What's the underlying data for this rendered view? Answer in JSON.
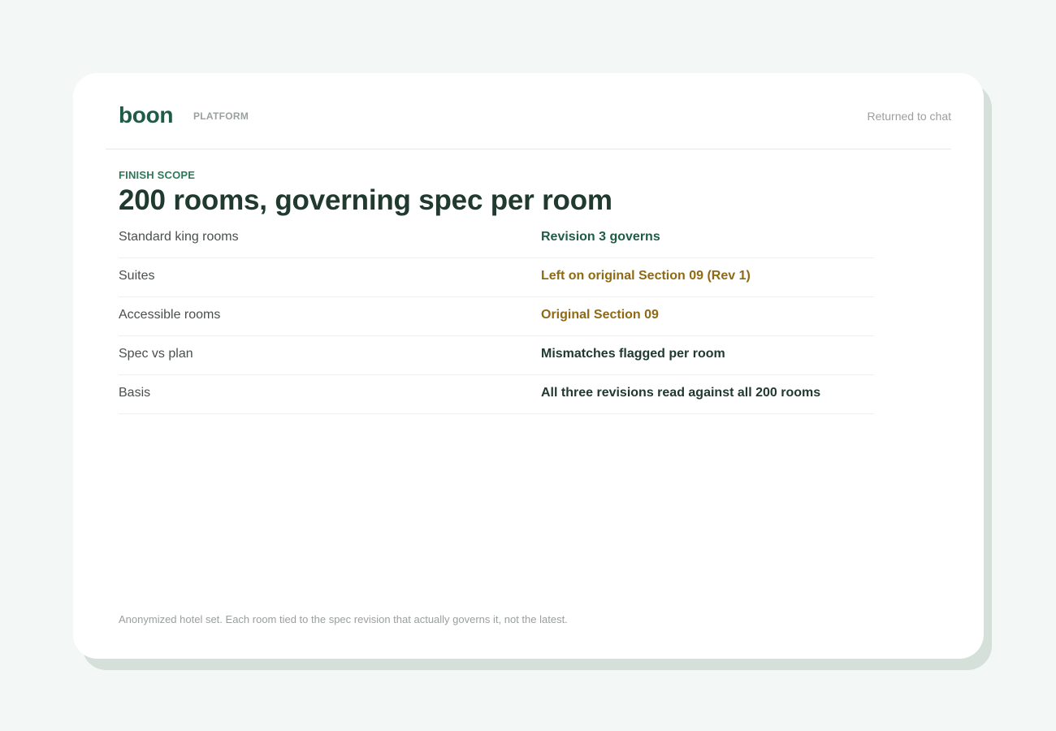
{
  "header": {
    "logo": "boon",
    "product": "PLATFORM",
    "status": "Returned to chat"
  },
  "section": {
    "eyebrow": "FINISH SCOPE",
    "title": "200 rooms, governing spec per room"
  },
  "rows": [
    {
      "label": "Standard king rooms",
      "value": "Revision 3 governs",
      "tone": "green"
    },
    {
      "label": "Suites",
      "value": "Left on original Section 09 (Rev 1)",
      "tone": "amber"
    },
    {
      "label": "Accessible rooms",
      "value": "Original Section 09",
      "tone": "amber"
    },
    {
      "label": "Spec vs plan",
      "value": "Mismatches flagged per room",
      "tone": "dark"
    },
    {
      "label": "Basis",
      "value": "All three revisions read against all 200 rooms",
      "tone": "dark"
    }
  ],
  "footnote": "Anonymized hotel set. Each room tied to the spec revision that actually governs it, not the latest.",
  "colors": {
    "brand_green": "#1f5c45",
    "accent_green": "#2d7a5a",
    "amber": "#8f6a14",
    "heading": "#203a30"
  }
}
